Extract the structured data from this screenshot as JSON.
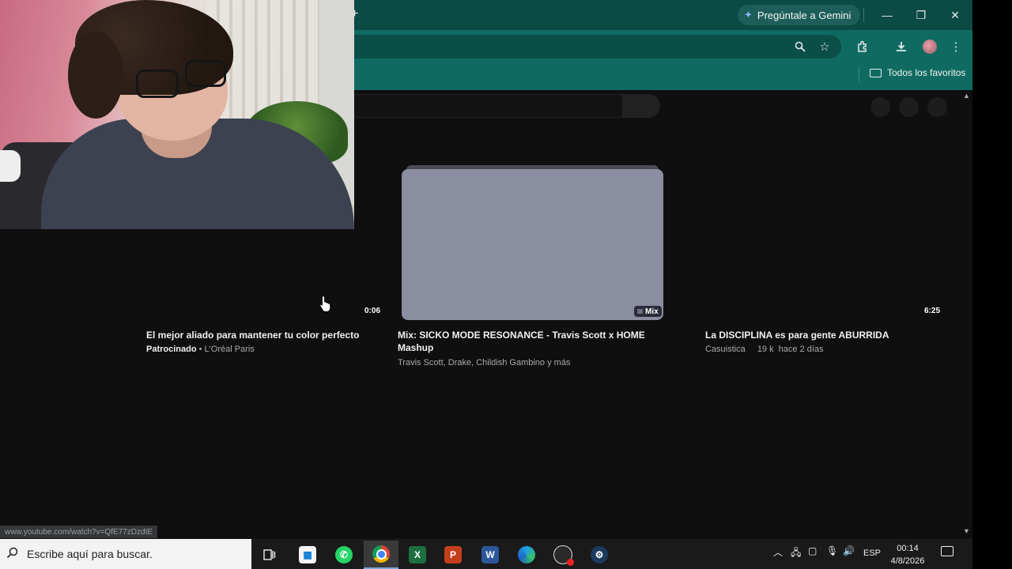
{
  "browser": {
    "new_tab_glyph": "+",
    "gemini_label": "Pregúntale a Gemini",
    "minimize": "—",
    "restore": "❐",
    "close": "✕",
    "bookmarks_folder": "Todos los favoritos"
  },
  "videos": [
    {
      "duration": "0:06",
      "title": "El mejor aliado para mantener tu color perfecto",
      "sponsored": "Patrocinado",
      "channel": " • L'Oréal Paris"
    },
    {
      "badge": "Mix",
      "title_line1": "Mix: SICKO MODE RESONANCE - Travis Scott x HOME",
      "title_line2": "Mashup",
      "channel": "Travis Scott, Drake, Childish Gambino y más"
    },
    {
      "duration": "6:25",
      "title": "La DISCIPLINA es para gente ABURRIDA",
      "channel": "Casuistica",
      "views": "19 k",
      "age": "hace 2 días"
    }
  ],
  "status_url": "www.youtube.com/watch?v=QfE77zDzdtE",
  "taskbar": {
    "search_placeholder": "Escribe aquí para buscar.",
    "language": "ESP",
    "time": "00:14",
    "date": "4/8/2026"
  },
  "colors": {
    "chrome_title": "#0c4a44",
    "chrome_toolbar": "#0f6b62",
    "page_bg": "#0f0f0f",
    "thumb": "#8b8da1"
  }
}
